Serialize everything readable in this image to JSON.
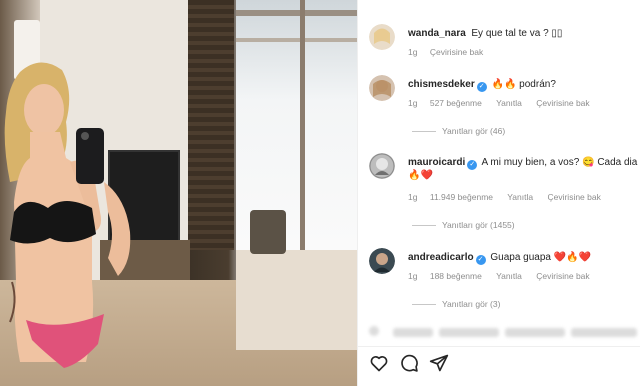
{
  "comments": [
    {
      "username": "wanda_nara",
      "verified": false,
      "text": "Ey que tal te va ? ▯▯",
      "time": "1g",
      "translate": "Çevirisine bak"
    },
    {
      "username": "chismesdeker",
      "verified": true,
      "text": "🔥🔥 podrán?",
      "time": "1g",
      "likes": "527 beğenme",
      "reply": "Yanıtla",
      "translate": "Çevirisine bak",
      "view_replies": "Yanıtları gör (46)"
    },
    {
      "username": "mauroicardi",
      "verified": true,
      "text": "A mi muy bien, a vos? 😋 Cada dia",
      "emoji_line": "🔥❤️",
      "time": "1g",
      "likes": "11.949 beğenme",
      "reply": "Yanıtla",
      "translate": "Çevirisine bak",
      "view_replies": "Yanıtları gör (1455)"
    },
    {
      "username": "andreadicarlo",
      "verified": true,
      "text": "Guapa guapa ❤️🔥❤️",
      "time": "1g",
      "likes": "188 beğenme",
      "reply": "Yanıtla",
      "translate": "Çevirisine bak",
      "view_replies": "Yanıtları gör (3)"
    }
  ],
  "icons": {
    "verified": "verified-badge-icon",
    "like": "heart-icon",
    "comment": "comment-icon",
    "share": "share-icon"
  },
  "colors": {
    "verified": "#3897f0",
    "muted": "#8e8e8e",
    "text": "#262626"
  }
}
